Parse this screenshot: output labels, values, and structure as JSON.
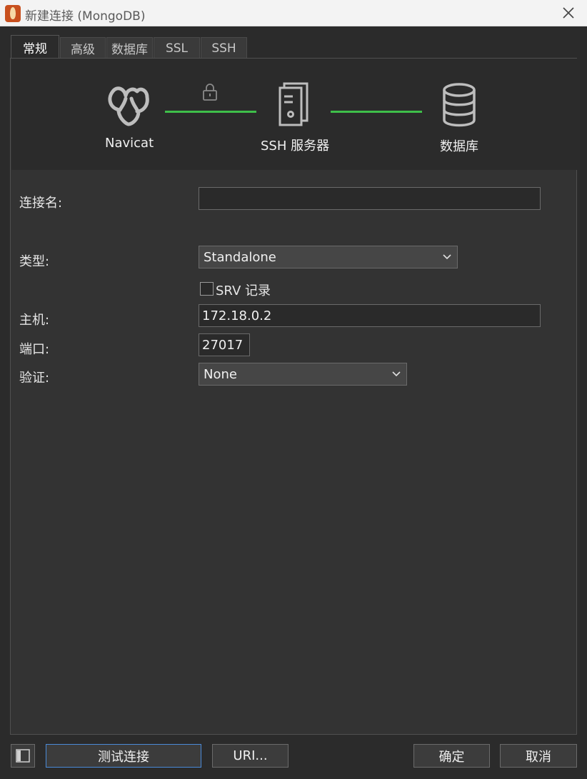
{
  "window": {
    "title": "新建连接 (MongoDB)"
  },
  "tabs": [
    {
      "label": "常规",
      "active": true
    },
    {
      "label": "高级",
      "active": false
    },
    {
      "label": "数据库",
      "active": false
    },
    {
      "label": "SSL",
      "active": false
    },
    {
      "label": "SSH",
      "active": false
    }
  ],
  "diagram": {
    "navicat_label": "Navicat",
    "ssh_label": "SSH 服务器",
    "db_label": "数据库",
    "line_color": "#3fbf4a"
  },
  "form": {
    "connection_name": {
      "label": "连接名:",
      "value": ""
    },
    "type": {
      "label": "类型:",
      "value": "Standalone"
    },
    "srv": {
      "label": "SRV 记录",
      "checked": false
    },
    "host": {
      "label": "主机:",
      "value": "172.18.0.2"
    },
    "port": {
      "label": "端口:",
      "value": "27017"
    },
    "auth": {
      "label": "验证:",
      "value": "None"
    }
  },
  "buttons": {
    "test": "测试连接",
    "uri": "URI...",
    "ok": "确定",
    "cancel": "取消"
  },
  "colors": {
    "accent_border": "#4a8ad8",
    "app_icon": "#c8501e"
  }
}
